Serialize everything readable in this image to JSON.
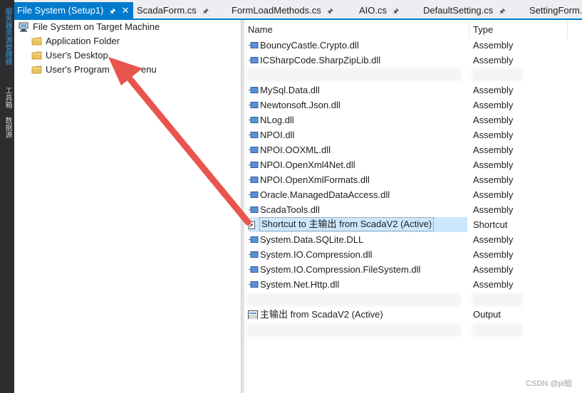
{
  "left_strip": {
    "tabs": [
      "服务器资源管理器",
      "工具箱",
      "数据源"
    ]
  },
  "tabs": [
    {
      "label": "File System (Setup1)",
      "active": true
    },
    {
      "label": "ScadaForm.cs",
      "active": false
    },
    {
      "label": "FormLoadMethods.cs",
      "active": false
    },
    {
      "label": "AIO.cs",
      "active": false
    },
    {
      "label": "DefaultSetting.cs",
      "active": false
    },
    {
      "label": "SettingForm.",
      "active": false
    }
  ],
  "tree": {
    "root": "File System on Target Machine",
    "children": [
      "Application Folder",
      "User's Desktop",
      "User's Programs Menu"
    ],
    "partially_hidden_label": "User's Program",
    "partially_hidden_suffix": "enu"
  },
  "list": {
    "columns": {
      "name": "Name",
      "type": "Type"
    },
    "rows": [
      {
        "name": "BouncyCastle.Crypto.dll",
        "type": "Assembly"
      },
      {
        "name": "ICSharpCode.SharpZipLib.dll",
        "type": "Assembly"
      },
      {
        "name": "MySql.Data.dll",
        "type": "Assembly"
      },
      {
        "name": "Newtonsoft.Json.dll",
        "type": "Assembly"
      },
      {
        "name": "NLog.dll",
        "type": "Assembly"
      },
      {
        "name": "NPOI.dll",
        "type": "Assembly"
      },
      {
        "name": "NPOI.OOXML.dll",
        "type": "Assembly"
      },
      {
        "name": "NPOI.OpenXml4Net.dll",
        "type": "Assembly"
      },
      {
        "name": "NPOI.OpenXmlFormats.dll",
        "type": "Assembly"
      },
      {
        "name": "Oracle.ManagedDataAccess.dll",
        "type": "Assembly"
      },
      {
        "name": "ScadaTools.dll",
        "type": "Assembly"
      },
      {
        "name": "Shortcut to 主输出 from ScadaV2 (Active)",
        "type": "Shortcut"
      },
      {
        "name": "System.Data.SQLite.DLL",
        "type": "Assembly"
      },
      {
        "name": "System.IO.Compression.dll",
        "type": "Assembly"
      },
      {
        "name": "System.IO.Compression.FileSystem.dll",
        "type": "Assembly"
      },
      {
        "name": "System.Net.Http.dll",
        "type": "Assembly"
      },
      {
        "name": "主输出 from ScadaV2 (Active)",
        "type": "Output"
      }
    ]
  },
  "watermark": "CSDN @pi蛆",
  "colors": {
    "accent": "#007acc",
    "selection": "#cce8ff",
    "arrow": "#e8554e",
    "folder": "#e8c25a"
  }
}
